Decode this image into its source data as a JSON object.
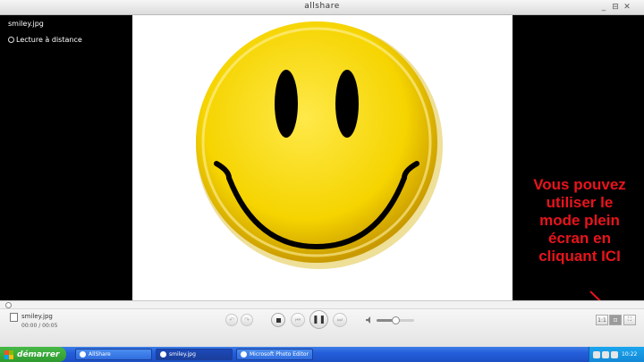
{
  "window": {
    "title": "allshare",
    "controls": [
      "_",
      "⊟",
      "✕"
    ]
  },
  "video": {
    "filename": "smiley.jpg",
    "remote_label": "Lecture à distance",
    "annotation_lines": [
      "Vous pouvez",
      "utiliser le",
      "mode plein",
      "écran en",
      "cliquant ICI"
    ],
    "annotation_color": "#e8141c"
  },
  "controlbar": {
    "filename": "smiley.jpg",
    "time": "00:00 / 00:05",
    "volume_fraction": 0.5,
    "zoom_buttons": [
      "1:1",
      "⊡",
      "⛶"
    ]
  },
  "taskbar": {
    "start_label": "démarrer",
    "items": [
      {
        "label": "AllShare"
      },
      {
        "label": "smiley.jpg"
      },
      {
        "label": "Microsoft Photo Editor"
      }
    ],
    "clock": "10:22"
  },
  "colors": {
    "smiley_yellow": "#f5d400",
    "taskbar_blue": "#245edb",
    "start_green": "#3aa83a"
  }
}
